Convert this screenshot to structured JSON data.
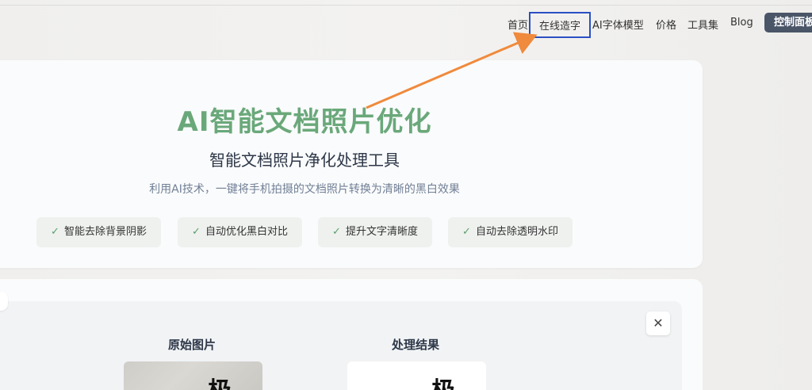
{
  "nav": {
    "items": [
      {
        "label": "首页"
      },
      {
        "label": "在线造字"
      },
      {
        "label": "AI字体模型"
      },
      {
        "label": "价格"
      },
      {
        "label": "工具集"
      },
      {
        "label": "Blog"
      }
    ],
    "dashboard_label": "控制面板"
  },
  "hero": {
    "title": "AI智能文档照片优化",
    "subtitle": "智能文档照片净化处理工具",
    "description": "利用AI技术，一键将手机拍摄的文档照片转换为清晰的黑白效果",
    "features": [
      {
        "label": "智能去除背景阴影"
      },
      {
        "label": "自动优化黑白对比"
      },
      {
        "label": "提升文字清晰度"
      },
      {
        "label": "自动去除透明水印"
      }
    ]
  },
  "workspace": {
    "original_title": "原始图片",
    "result_title": "处理结果",
    "close_icon": "close-icon"
  },
  "colors": {
    "accent_green": "#6aa87a",
    "highlight_box": "#2b4fc4",
    "arrow": "#f08a3c",
    "dashboard_bg": "#4a5568"
  }
}
